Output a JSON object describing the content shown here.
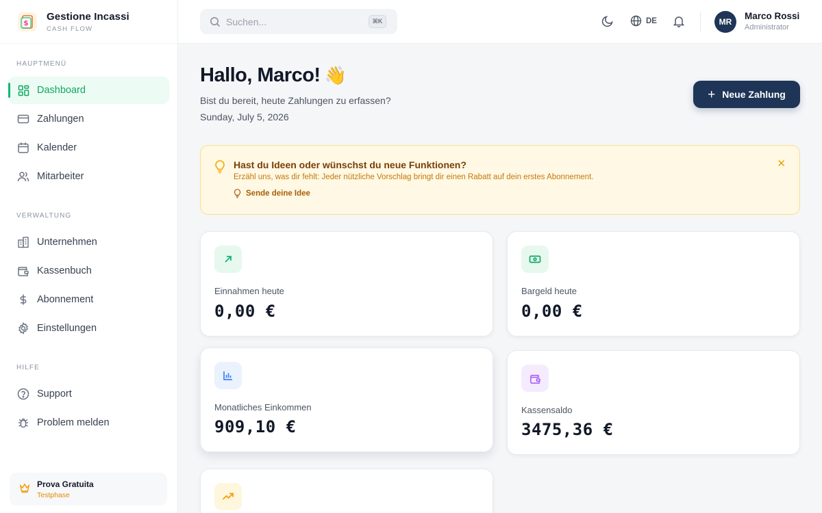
{
  "brand": {
    "name": "Gestione Incassi",
    "tagline": "CASH FLOW"
  },
  "sidebar": {
    "sections": [
      {
        "title": "HAUPTMENÜ"
      },
      {
        "title": "VERWALTUNG"
      },
      {
        "title": "HILFE"
      }
    ],
    "items": [
      {
        "label": "Dashboard",
        "icon": "dashboard-icon",
        "active": true
      },
      {
        "label": "Zahlungen",
        "icon": "credit-card-icon"
      },
      {
        "label": "Kalender",
        "icon": "calendar-icon"
      },
      {
        "label": "Mitarbeiter",
        "icon": "users-icon"
      },
      {
        "label": "Unternehmen",
        "icon": "building-icon"
      },
      {
        "label": "Kassenbuch",
        "icon": "wallet-icon"
      },
      {
        "label": "Abonnement",
        "icon": "dollar-icon"
      },
      {
        "label": "Einstellungen",
        "icon": "gear-icon"
      },
      {
        "label": "Support",
        "icon": "help-circle-icon"
      },
      {
        "label": "Problem melden",
        "icon": "bug-icon"
      }
    ],
    "trial": {
      "title": "Prova Gratuita",
      "subtitle": "Testphase"
    }
  },
  "topbar": {
    "search_placeholder": "Suchen...",
    "shortcut": "⌘K",
    "language": "DE",
    "user": {
      "initials": "MR",
      "name": "Marco Rossi",
      "role": "Administrator"
    }
  },
  "main": {
    "greeting": "Hallo, Marco!",
    "greeting_emoji": "👋",
    "subline": "Bist du bereit, heute Zahlungen zu erfassen?",
    "date": "Sunday, July 5, 2026",
    "new_button": "Neue Zahlung",
    "idea_banner": {
      "title": "Hast du Ideen oder wünschst du neue Funktionen?",
      "description": "Erzähl uns, was dir fehlt: Jeder nützliche Vorschlag bringt dir einen Rabatt auf dein erstes Abonnement.",
      "action": "Sende deine Idee"
    },
    "cards": [
      {
        "label": "Einnahmen heute",
        "value": "0,00 €",
        "icon": "arrow-up-right-icon",
        "color": "#10b872"
      },
      {
        "label": "Bargeld heute",
        "value": "0,00 €",
        "icon": "banknote-icon",
        "color": "#10a862"
      },
      {
        "label": "Monatliches Einkommen",
        "value": "909,10 €",
        "icon": "bar-chart-icon",
        "color": "#3b82f6"
      },
      {
        "label": "Kassensaldo",
        "value": "3475,36 €",
        "icon": "wallet-icon",
        "color": "#a855f7"
      },
      {
        "label": "",
        "value": "",
        "icon": "trending-up-icon",
        "color": "#f59e0b"
      }
    ]
  }
}
